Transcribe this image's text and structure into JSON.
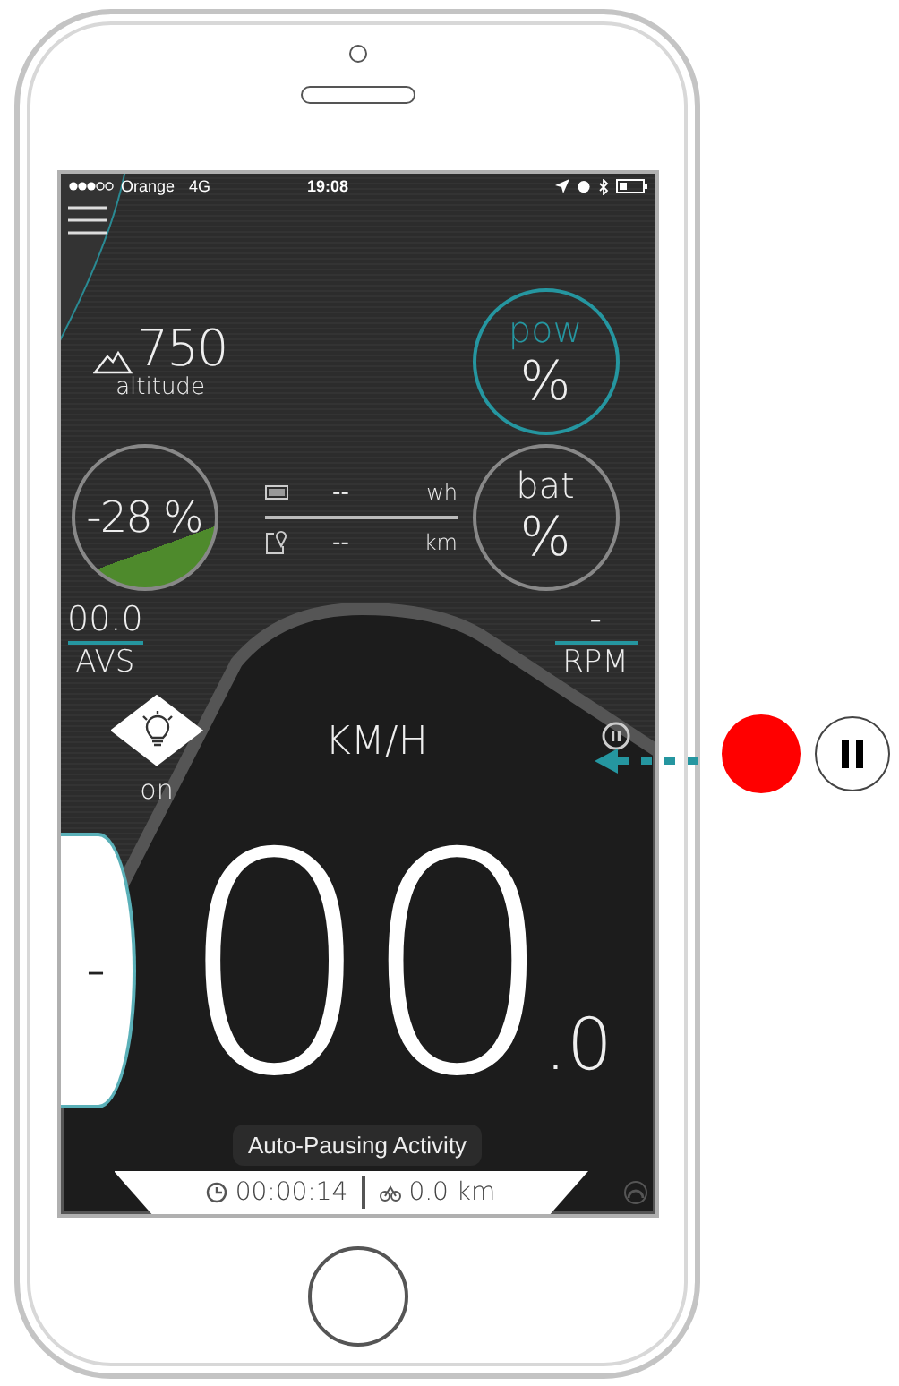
{
  "status_bar": {
    "carrier": "Orange",
    "network": "4G",
    "time": "19:08"
  },
  "altitude": {
    "value": "750",
    "label": "altitude"
  },
  "power": {
    "label": "pow",
    "value": "%"
  },
  "grade": {
    "value": "-28 %"
  },
  "energy": [
    {
      "kind": "battery",
      "value": "--",
      "unit": "wh"
    },
    {
      "kind": "range",
      "value": "--",
      "unit": "km"
    }
  ],
  "battery": {
    "label": "bat",
    "value": "%"
  },
  "avs": {
    "value": "00.0",
    "label": "AVS"
  },
  "rpm": {
    "value": "-",
    "label": "RPM"
  },
  "light": {
    "label": "on"
  },
  "speed": {
    "unit": "KM/H",
    "value": "00",
    "decimal": ".0"
  },
  "side_dial": {
    "value": "–"
  },
  "toast": "Auto-Pausing Activity",
  "trip": {
    "time": "00:00:14",
    "distance": "0.0 km"
  },
  "callout": [
    {
      "kind": "record"
    },
    {
      "kind": "pause"
    }
  ]
}
